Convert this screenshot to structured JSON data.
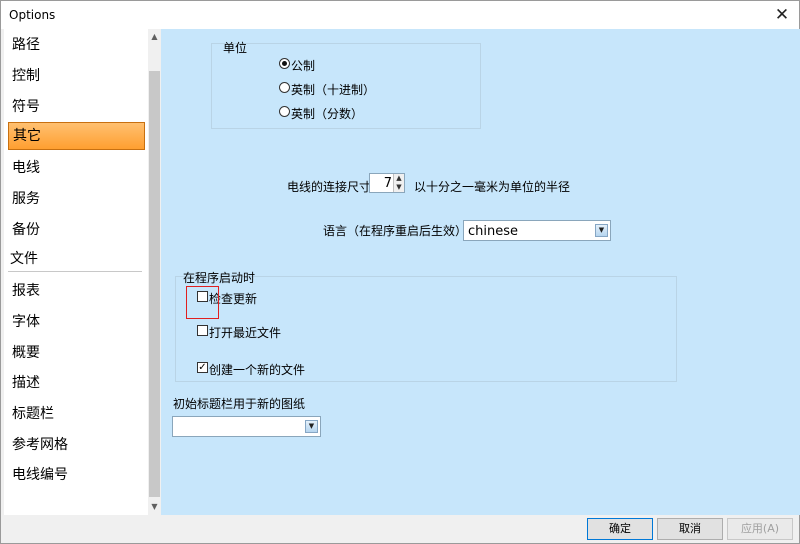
{
  "window": {
    "title": "Options",
    "close_glyph": "✕"
  },
  "sidebar": {
    "items": [
      {
        "label": "路径",
        "selected": false
      },
      {
        "label": "控制",
        "selected": false
      },
      {
        "label": "符号",
        "selected": false
      },
      {
        "label": "其它",
        "selected": true
      },
      {
        "label": "电线",
        "selected": false
      },
      {
        "label": "服务",
        "selected": false
      },
      {
        "label": "备份",
        "selected": false
      }
    ],
    "group": {
      "label": "文件"
    },
    "group_items": [
      {
        "label": "报表"
      },
      {
        "label": "字体"
      },
      {
        "label": "概要"
      },
      {
        "label": "描述"
      },
      {
        "label": "标题栏"
      },
      {
        "label": "参考网格"
      },
      {
        "label": "电线编号"
      }
    ],
    "scroll_up": "▲",
    "scroll_down": "▼"
  },
  "units": {
    "title": "单位",
    "options": [
      {
        "label": "公制",
        "selected": true
      },
      {
        "label": "英制（十进制）",
        "selected": false
      },
      {
        "label": "英制（分数）",
        "selected": false
      }
    ]
  },
  "wire": {
    "label": "电线的连接尺寸",
    "value": "7",
    "suffix": "以十分之一毫米为单位的半径",
    "up": "▲",
    "down": "▼"
  },
  "language": {
    "label": "语言（在程序重启后生效）",
    "value": "chinese",
    "arrow": "▼"
  },
  "startup": {
    "title": "在程序启动时",
    "options": [
      {
        "label": "检查更新",
        "checked": false
      },
      {
        "label": "打开最近文件",
        "checked": false
      },
      {
        "label": "创建一个新的文件",
        "checked": true
      }
    ],
    "check_mark": "✓"
  },
  "title_block": {
    "label": "初始标题栏用于新的图纸",
    "value": "",
    "arrow": "▼"
  },
  "buttons": {
    "ok": "确定",
    "cancel": "取消",
    "apply": "应用(A)"
  },
  "colors": {
    "content_bg": "#c7e6fb",
    "selected_item": "#ff9f30",
    "highlight_box": "#e02020",
    "default_button_border": "#0078d7"
  }
}
